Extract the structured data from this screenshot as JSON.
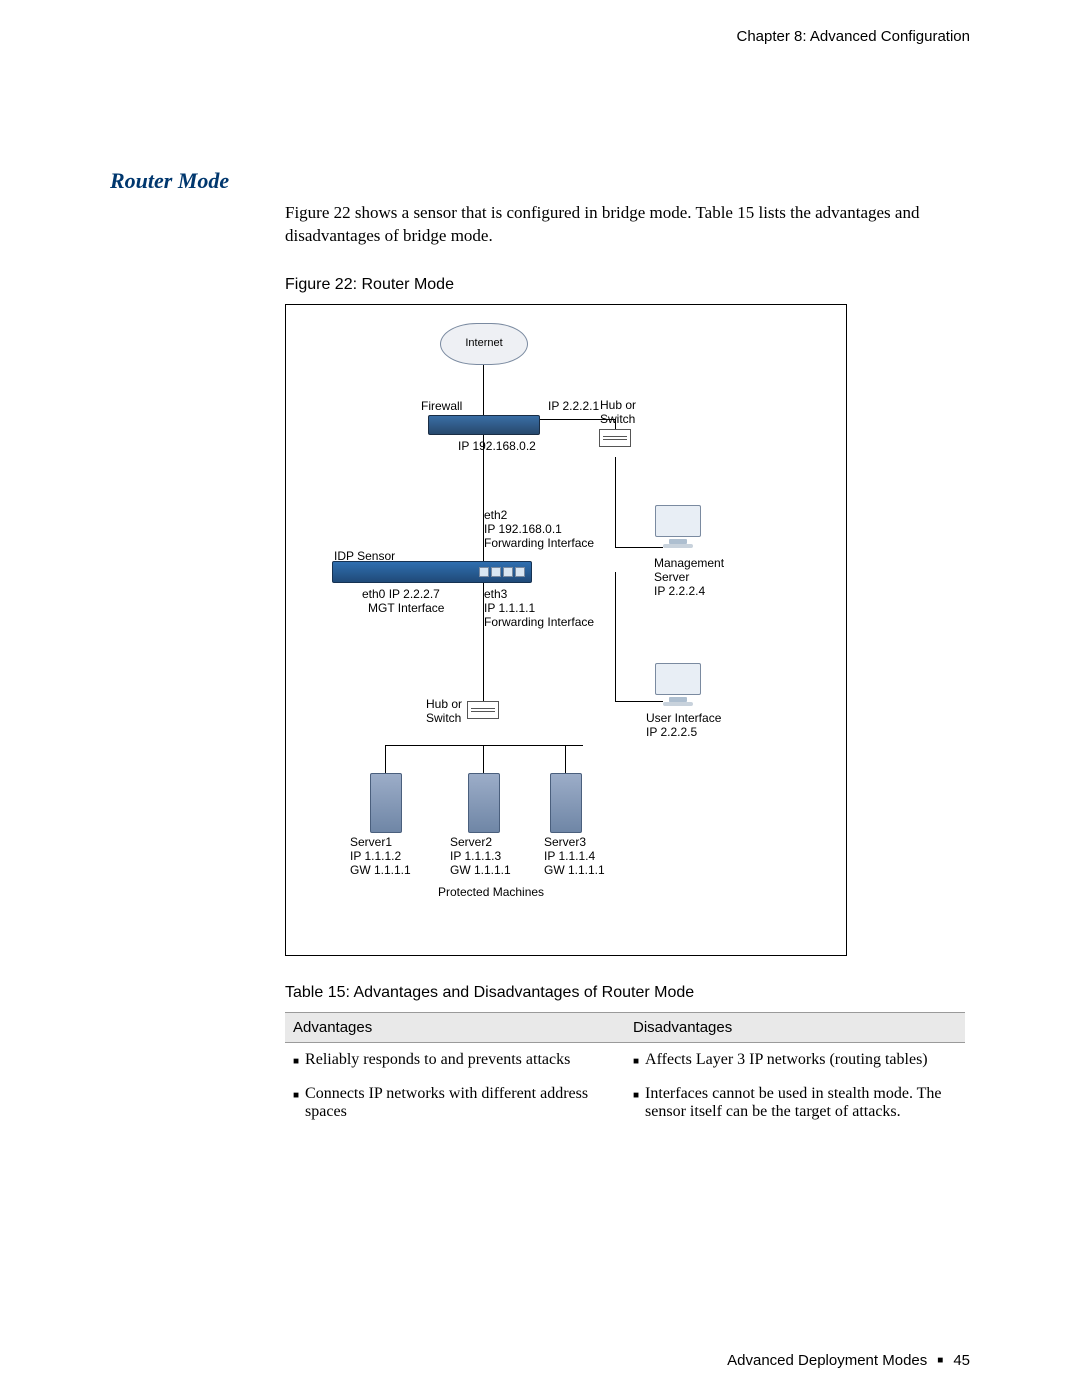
{
  "header": {
    "chapter": "Chapter 8: Advanced Configuration"
  },
  "section": {
    "title": "Router Mode"
  },
  "intro": {
    "text": "Figure 22 shows a sensor that is configured in bridge mode. Table 15 lists the advantages and disadvantages of bridge mode."
  },
  "figure": {
    "caption": "Figure 22:  Router Mode",
    "labels": {
      "internet": "Internet",
      "firewall": "Firewall",
      "firewall_ip_outer": "IP 2.2.2.1",
      "firewall_ip_inner": "IP 192.168.0.2",
      "hub_top": "Hub or",
      "switch_top": "Switch",
      "idp_sensor": "IDP Sensor",
      "eth2_line1": "eth2",
      "eth2_line2": "IP 192.168.0.1",
      "eth2_line3": "Forwarding Interface",
      "eth0_line1": "eth0 IP 2.2.2.7",
      "eth0_line2": "MGT Interface",
      "eth3_line1": "eth3",
      "eth3_line2": "IP 1.1.1.1",
      "eth3_line3": "Forwarding Interface",
      "mgmt_line1": "Management",
      "mgmt_line2": "Server",
      "mgmt_line3": "IP 2.2.2.4",
      "ui_line1": "User Interface",
      "ui_line2": "IP 2.2.2.5",
      "hub_bottom": "Hub or",
      "switch_bottom": "Switch",
      "server1_l1": "Server1",
      "server1_l2": "IP 1.1.1.2",
      "server1_l3": "GW 1.1.1.1",
      "server2_l1": "Server2",
      "server2_l2": "IP 1.1.1.3",
      "server2_l3": "GW 1.1.1.1",
      "server3_l1": "Server3",
      "server3_l2": "IP 1.1.1.4",
      "server3_l3": "GW 1.1.1.1",
      "protected": "Protected Machines"
    }
  },
  "table": {
    "caption": "Table 15:  Advantages and Disadvantages of Router Mode",
    "headers": {
      "advantages": "Advantages",
      "disadvantages": "Disadvantages"
    },
    "rows": [
      {
        "adv": "Reliably responds to and prevents attacks",
        "dis": "Affects Layer 3 IP networks (routing tables)"
      },
      {
        "adv": "Connects IP networks with different address spaces",
        "dis": "Interfaces cannot be used in stealth mode. The sensor itself can be the target of attacks."
      }
    ]
  },
  "footer": {
    "section": "Advanced Deployment Modes",
    "page": "45"
  }
}
